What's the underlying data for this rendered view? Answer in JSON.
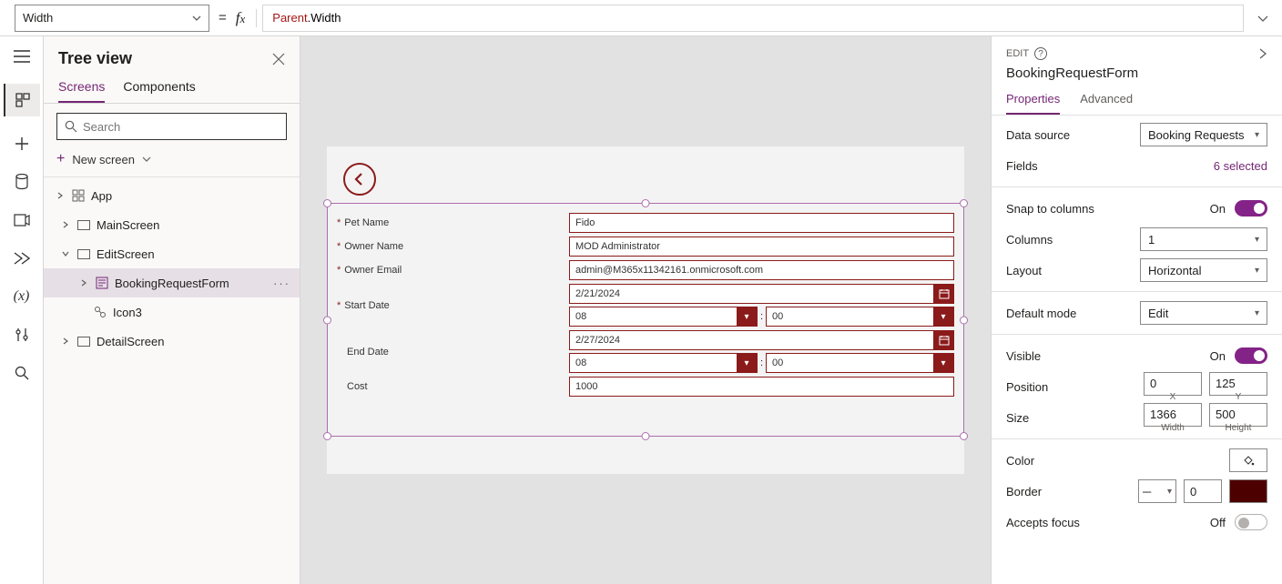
{
  "formula": {
    "property": "Width",
    "expr_parent": "Parent",
    "expr_dot": ".",
    "expr_prop": "Width"
  },
  "treeview": {
    "title": "Tree view",
    "tab_screens": "Screens",
    "tab_components": "Components",
    "search_placeholder": "Search",
    "new_screen": "New screen",
    "items": {
      "app": "App",
      "mainscreen": "MainScreen",
      "editscreen": "EditScreen",
      "bookingform": "BookingRequestForm",
      "icon3": "Icon3",
      "detailscreen": "DetailScreen"
    }
  },
  "form": {
    "fields": {
      "pet_name_label": "Pet Name",
      "pet_name_value": "Fido",
      "owner_name_label": "Owner Name",
      "owner_name_value": "MOD Administrator",
      "owner_email_label": "Owner Email",
      "owner_email_value": "admin@M365x11342161.onmicrosoft.com",
      "start_date_label": "Start Date",
      "start_date_value": "2/21/2024",
      "start_hour": "08",
      "start_min": "00",
      "end_date_label": "End Date",
      "end_date_value": "2/27/2024",
      "end_hour": "08",
      "end_min": "00",
      "cost_label": "Cost",
      "cost_value": "1000",
      "asterisk": "*",
      "colon": ":"
    }
  },
  "props": {
    "edit_label": "EDIT",
    "control_name": "BookingRequestForm",
    "tab_props": "Properties",
    "tab_adv": "Advanced",
    "data_source_label": "Data source",
    "data_source_value": "Booking Requests",
    "fields_label": "Fields",
    "fields_value": "6 selected",
    "snap_label": "Snap to columns",
    "snap_value": "On",
    "columns_label": "Columns",
    "columns_value": "1",
    "layout_label": "Layout",
    "layout_value": "Horizontal",
    "defaultmode_label": "Default mode",
    "defaultmode_value": "Edit",
    "visible_label": "Visible",
    "visible_value": "On",
    "position_label": "Position",
    "pos_x": "0",
    "pos_y": "125",
    "pos_x_sub": "X",
    "pos_y_sub": "Y",
    "size_label": "Size",
    "size_w": "1366",
    "size_h": "500",
    "size_w_sub": "Width",
    "size_h_sub": "Height",
    "color_label": "Color",
    "border_label": "Border",
    "border_width": "0",
    "accepts_focus_label": "Accepts focus",
    "accepts_focus_value": "Off",
    "border_style_value": "─"
  }
}
